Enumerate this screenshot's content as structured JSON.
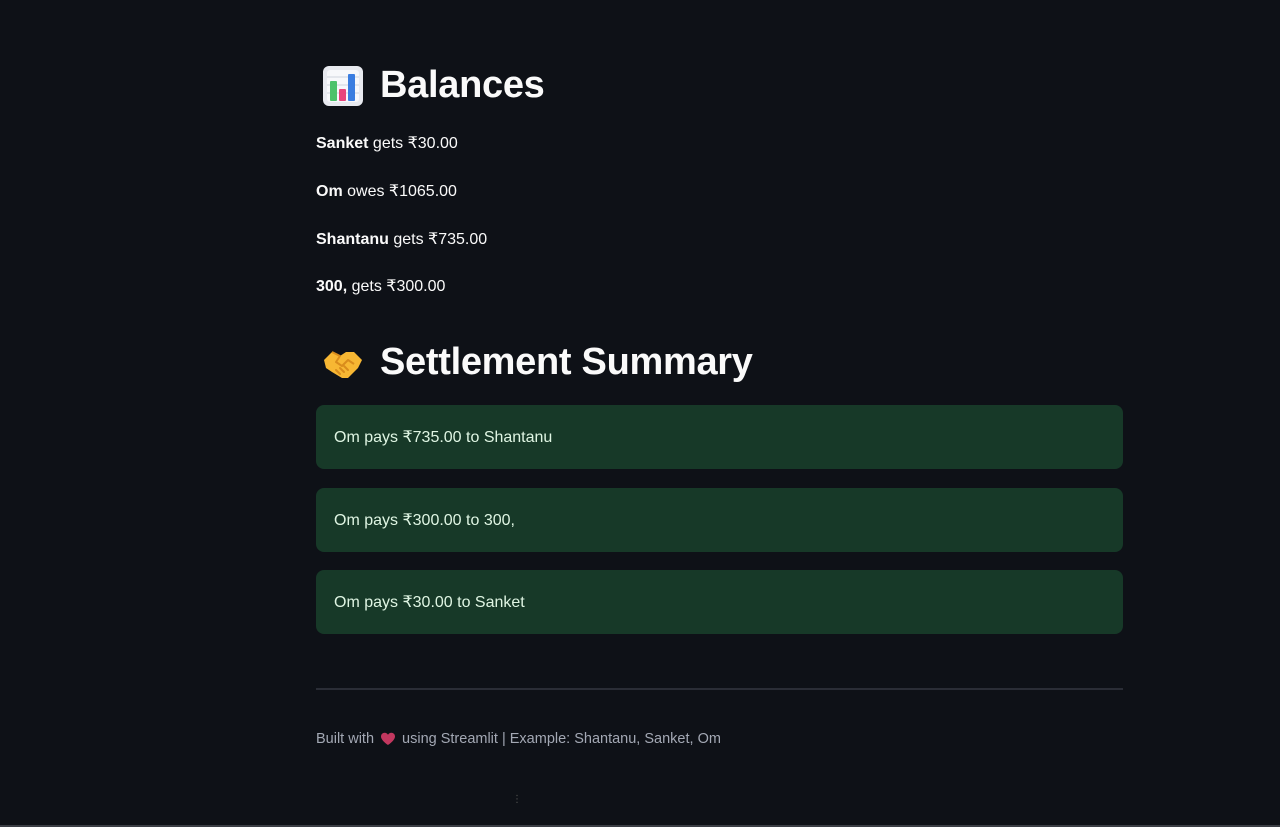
{
  "balances": {
    "title": "Balances",
    "icon": "bar-chart-icon",
    "items": [
      {
        "name": "Sanket",
        "text": " gets ₹30.00"
      },
      {
        "name": "Om",
        "text": " owes ₹1065.00"
      },
      {
        "name": "Shantanu",
        "text": " gets ₹735.00"
      },
      {
        "name": "300,",
        "text": " gets ₹300.00"
      }
    ]
  },
  "settlement": {
    "title": "Settlement Summary",
    "icon": "handshake-icon",
    "items": [
      "Om pays ₹735.00 to Shantanu",
      "Om pays ₹300.00 to 300,",
      "Om pays ₹30.00 to Sanket"
    ]
  },
  "footer": {
    "prefix": "Built with",
    "suffix": "using Streamlit | Example: Shantanu, Sanket, Om",
    "icon": "heart-icon"
  },
  "colors": {
    "background": "#0e1117",
    "success_bg": "#173928",
    "success_text": "#dff5e3"
  }
}
